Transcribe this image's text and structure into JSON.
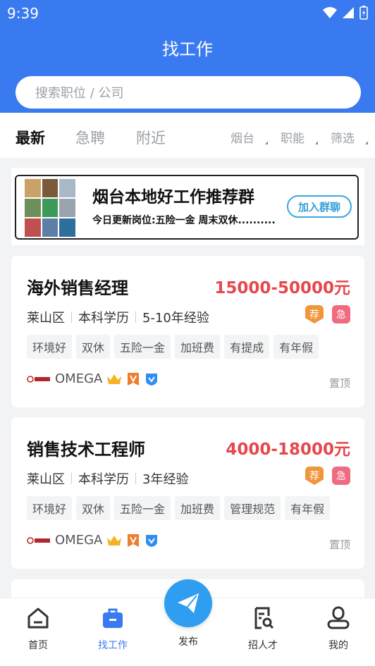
{
  "status": {
    "time": "9:39"
  },
  "header": {
    "title": "找工作",
    "search_placeholder": "搜索职位 / 公司"
  },
  "tabs": [
    {
      "label": "最新",
      "active": true
    },
    {
      "label": "急聘",
      "active": false
    },
    {
      "label": "附近",
      "active": false
    }
  ],
  "filters": [
    {
      "label": "烟台"
    },
    {
      "label": "职能"
    },
    {
      "label": "筛选"
    }
  ],
  "banner": {
    "title": "烟台本地好工作推荐群",
    "subtitle": "今日更新岗位:五险一金 周末双休..........",
    "button": "加入群聊"
  },
  "jobs": [
    {
      "title": "海外销售经理",
      "salary": "15000-50000元",
      "district": "莱山区",
      "education": "本科学历",
      "experience": "5-10年经验",
      "badge_rec": "荐",
      "badge_urgent": "急",
      "tags": [
        "环境好",
        "双休",
        "五险一金",
        "加班费",
        "有提成",
        "有年假"
      ],
      "company": "OMEGA",
      "pin": "置顶"
    },
    {
      "title": "销售技术工程师",
      "salary": "4000-18000元",
      "district": "莱山区",
      "education": "本科学历",
      "experience": "3年经验",
      "badge_rec": "荐",
      "badge_urgent": "急",
      "tags": [
        "环境好",
        "双休",
        "五险一金",
        "加班费",
        "管理规范",
        "有年假"
      ],
      "company": "OMEGA",
      "pin": "置顶"
    }
  ],
  "nav": {
    "home": "首页",
    "jobs": "找工作",
    "publish": "发布",
    "talent": "招人才",
    "mine": "我的"
  },
  "colors": {
    "primary": "#3a7af0",
    "salary": "#e5484d",
    "publish": "#2f9ef0"
  }
}
